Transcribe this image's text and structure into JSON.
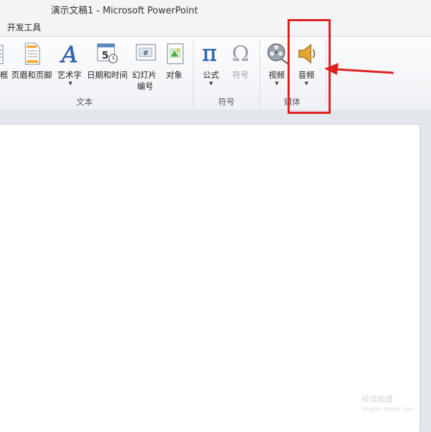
{
  "window": {
    "title": "演示文稿1  -  Microsoft PowerPoint"
  },
  "tabs": [
    {
      "label": "开发工具"
    }
  ],
  "ribbon": {
    "groups": [
      {
        "label": "文本",
        "buttons": [
          {
            "label": "框",
            "icon": "text-box-icon"
          },
          {
            "label": "页眉和页脚",
            "icon": "header-footer-icon"
          },
          {
            "label": "艺术字",
            "icon": "wordart-icon",
            "dropdown": true
          },
          {
            "label": "日期和时间",
            "icon": "date-time-icon"
          },
          {
            "label": "幻灯片\n编号",
            "label_line1": "幻灯片",
            "label_line2": "编号",
            "icon": "slide-number-icon"
          },
          {
            "label": "对象",
            "icon": "object-icon"
          }
        ]
      },
      {
        "label": "符号",
        "buttons": [
          {
            "label": "公式",
            "icon": "pi-icon",
            "dropdown": true
          },
          {
            "label": "符号",
            "icon": "omega-icon",
            "disabled": true
          }
        ]
      },
      {
        "label": "媒体",
        "buttons": [
          {
            "label": "视频",
            "icon": "film-reel-icon",
            "dropdown": true
          },
          {
            "label": "音频",
            "icon": "speaker-icon",
            "dropdown": true
          }
        ]
      }
    ]
  },
  "watermark": {
    "line1": "经验知道",
    "line2": "jingyan.baidu.com"
  },
  "colors": {
    "annotation": "#e02020",
    "ribbon_bg": "#f7f8fa"
  }
}
